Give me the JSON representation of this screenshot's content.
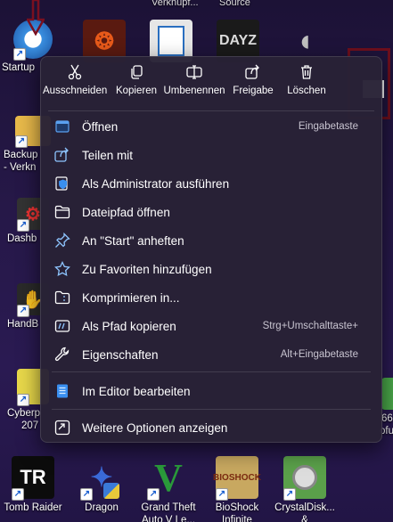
{
  "desktop": {
    "top_labels": [
      "Verknüpf...",
      "Source"
    ],
    "icons": [
      {
        "id": "startup",
        "label": "Startup",
        "color": "#3a8fe0"
      },
      {
        "id": "fire",
        "label": "",
        "color": "#c0391b"
      },
      {
        "id": "doc",
        "label": "",
        "color": "#e6e6e6"
      },
      {
        "id": "dayz",
        "label": "",
        "color": "#222222"
      },
      {
        "id": "speaker",
        "label": "",
        "color": "#b0b0b0"
      },
      {
        "id": "backup",
        "label": "Backup",
        "label2": "- Verkn",
        "color": "#e8b94a"
      },
      {
        "id": "dashb",
        "label": "Dashb",
        "color": "#333333"
      },
      {
        "id": "hande",
        "label": "HandB",
        "color": "#2a2a2a"
      },
      {
        "id": "cyber",
        "label": "Cyberp",
        "label2": "207",
        "color": "#e8d84a"
      },
      {
        "id": "right66",
        "label": "66",
        "label2": "ofu",
        "color": "#4aa84a"
      },
      {
        "id": "tombraider",
        "label": "Tomb Raider",
        "color": "#111111"
      },
      {
        "id": "dragon",
        "label": "Dragon",
        "color": "#1a3a8a"
      },
      {
        "id": "gta",
        "label": "Grand Theft",
        "label2": "Auto V Le...",
        "color": "#2a7a2a"
      },
      {
        "id": "bioshock",
        "label": "BioShock",
        "label2": "Infinite",
        "color": "#c8a860"
      },
      {
        "id": "crystal",
        "label": "CrystalDisk...",
        "label2": "&",
        "color": "#5aa04a"
      }
    ]
  },
  "quick_actions": [
    {
      "label": "Ausschneiden",
      "icon": "scissors-icon"
    },
    {
      "label": "Kopieren",
      "icon": "copy-icon"
    },
    {
      "label": "Umbenennen",
      "icon": "rename-icon"
    },
    {
      "label": "Freigabe",
      "icon": "share-icon"
    },
    {
      "label": "Löschen",
      "icon": "trash-icon"
    }
  ],
  "menu_items": [
    {
      "label": "Öffnen",
      "shortcut": "Eingabetaste",
      "icon": "open-app-icon"
    },
    {
      "label": "Teilen mit",
      "shortcut": "",
      "icon": "share-with-icon"
    },
    {
      "label": "Als Administrator ausführen",
      "shortcut": "",
      "icon": "admin-shield-icon"
    },
    {
      "label": "Dateipfad öffnen",
      "shortcut": "",
      "icon": "folder-icon"
    },
    {
      "label": "An \"Start\" anheften",
      "shortcut": "",
      "icon": "pin-icon"
    },
    {
      "label": "Zu Favoriten hinzufügen",
      "shortcut": "",
      "icon": "star-icon"
    },
    {
      "label": "Komprimieren in...",
      "shortcut": "",
      "icon": "zip-folder-icon"
    },
    {
      "label": "Als Pfad kopieren",
      "shortcut": "Strg+Umschalttaste+",
      "icon": "copy-path-icon"
    },
    {
      "label": "Eigenschaften",
      "shortcut": "Alt+Eingabetaste",
      "icon": "wrench-icon"
    },
    {
      "label": "Im Editor bearbeiten",
      "shortcut": "",
      "icon": "notepad-icon"
    },
    {
      "label": "Weitere Optionen anzeigen",
      "shortcut": "",
      "icon": "more-options-icon"
    }
  ],
  "colors": {
    "accent": "#60a8f0",
    "annotation": "#6e0f1d"
  }
}
